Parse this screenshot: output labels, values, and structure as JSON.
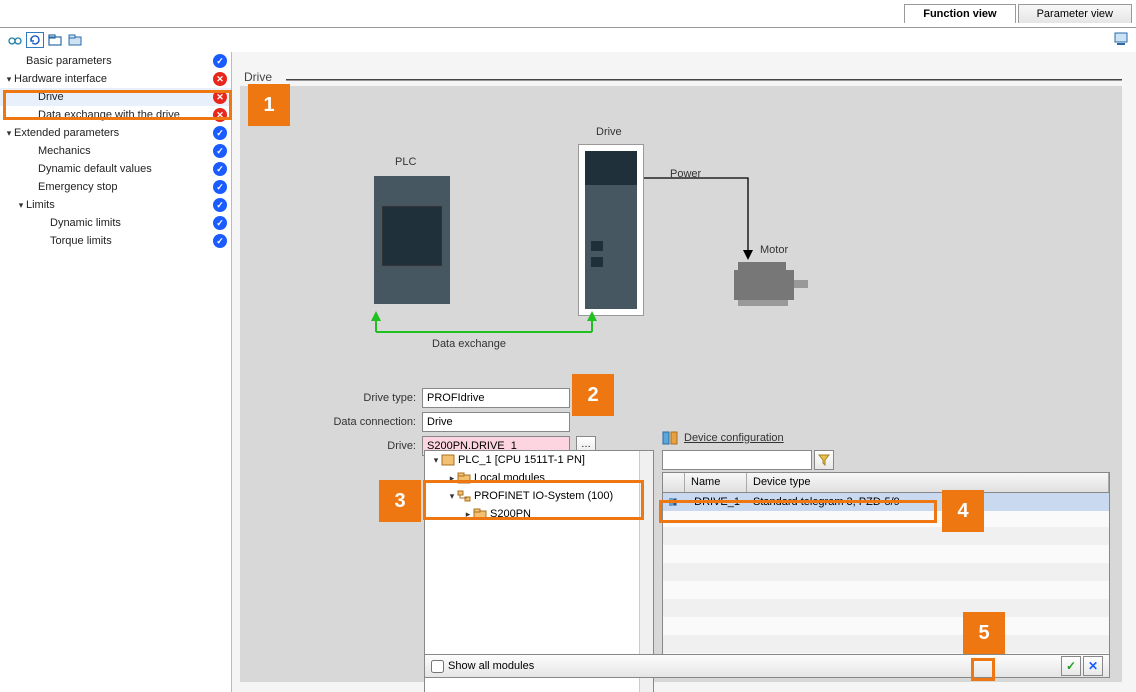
{
  "tabs": {
    "function_view": "Function view",
    "parameter_view": "Parameter view"
  },
  "sidebar": {
    "items": [
      {
        "label": "Basic parameters",
        "indent": 16,
        "toggle": "",
        "status": "ok"
      },
      {
        "label": "Hardware interface",
        "indent": 4,
        "toggle": "▼",
        "status": "err"
      },
      {
        "label": "Drive",
        "indent": 28,
        "toggle": "",
        "status": "err",
        "selected": true
      },
      {
        "label": "Data exchange with the drive",
        "indent": 28,
        "toggle": "",
        "status": "err"
      },
      {
        "label": "Extended parameters",
        "indent": 4,
        "toggle": "▼",
        "status": "ok"
      },
      {
        "label": "Mechanics",
        "indent": 28,
        "toggle": "",
        "status": "ok"
      },
      {
        "label": "Dynamic default values",
        "indent": 28,
        "toggle": "",
        "status": "ok"
      },
      {
        "label": "Emergency stop",
        "indent": 28,
        "toggle": "",
        "status": "ok"
      },
      {
        "label": "Limits",
        "indent": 16,
        "toggle": "▼",
        "status": "ok"
      },
      {
        "label": "Dynamic limits",
        "indent": 40,
        "toggle": "",
        "status": "ok"
      },
      {
        "label": "Torque limits",
        "indent": 40,
        "toggle": "",
        "status": "ok"
      }
    ]
  },
  "section": {
    "title": "Drive"
  },
  "diagram": {
    "plc": "PLC",
    "drive": "Drive",
    "power": "Power",
    "motor": "Motor",
    "data_exchange": "Data exchange"
  },
  "fields": {
    "drive_type_label": "Drive type:",
    "drive_type_value": "PROFIdrive",
    "data_conn_label": "Data connection:",
    "data_conn_value": "Drive",
    "drive_label": "Drive:",
    "drive_value": "S200PN.DRIVE_1"
  },
  "popup_tree": [
    {
      "label": "PLC_1 [CPU 1511T-1 PN]",
      "indent": 2,
      "toggle": "▼",
      "icon": "cpu"
    },
    {
      "label": "Local modules",
      "indent": 18,
      "toggle": "▶",
      "icon": "folder"
    },
    {
      "label": "PROFINET IO-System (100)",
      "indent": 18,
      "toggle": "▼",
      "icon": "network"
    },
    {
      "label": "S200PN",
      "indent": 34,
      "toggle": "▶",
      "icon": "folder"
    }
  ],
  "device_config": {
    "title": "Device configuration",
    "col_name": "Name",
    "col_type": "Device type",
    "row_name": "DRIVE_1",
    "row_type": "Standard telegram 3, PZD-5/9"
  },
  "bottom": {
    "show_all": "Show all modules"
  },
  "callouts": {
    "c1": "1",
    "c2": "2",
    "c3": "3",
    "c4": "4",
    "c5": "5"
  }
}
